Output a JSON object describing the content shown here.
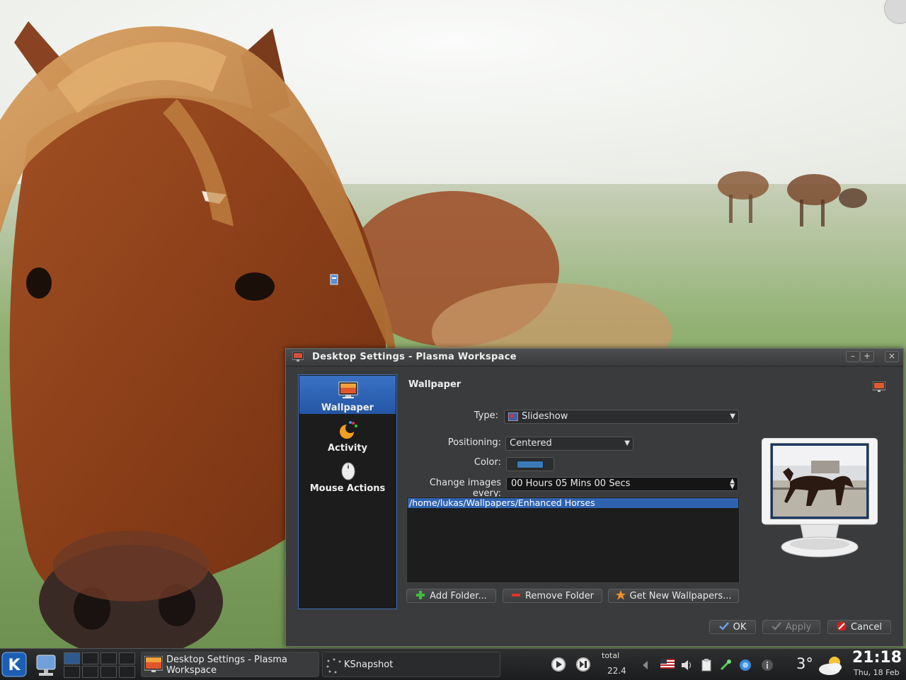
{
  "dialog": {
    "title": "Desktop Settings - Plasma Workspace",
    "window_buttons": {
      "minimize": "–",
      "maximize": "+",
      "close": "×"
    },
    "sidebar": {
      "items": [
        {
          "label": "Wallpaper",
          "icon": "wallpaper-icon",
          "selected": true
        },
        {
          "label": "Activity",
          "icon": "activity-icon",
          "selected": false
        },
        {
          "label": "Mouse Actions",
          "icon": "mouse-icon",
          "selected": false
        }
      ]
    },
    "section_title": "Wallpaper",
    "form": {
      "type_label": "Type:",
      "type_value": "Slideshow",
      "positioning_label": "Positioning:",
      "positioning_value": "Centered",
      "color_label": "Color:",
      "color_value": "#3a7ab8",
      "change_label": "Change images every:",
      "change_value": "00 Hours 05 Mins 00 Secs"
    },
    "folders": [
      "/home/lukas/Wallpapers/Enhanced Horses"
    ],
    "folder_buttons": {
      "add": "Add Folder...",
      "remove": "Remove Folder",
      "get_new": "Get New Wallpapers..."
    },
    "footer": {
      "ok": "OK",
      "apply": "Apply",
      "cancel": "Cancel"
    }
  },
  "taskbar": {
    "tasks": [
      {
        "label": "Desktop Settings - Plasma Workspace",
        "icon": "wallpaper-icon"
      },
      {
        "label": "KSnapshot",
        "icon": "loading-icon"
      }
    ],
    "net_widget": {
      "label": "total",
      "value": "22.4"
    },
    "weather": {
      "temp": "3°",
      "icon": "partly-cloudy-icon"
    },
    "clock": {
      "time": "21:18",
      "date": "Thu, 18 Feb"
    }
  },
  "colors": {
    "selection": "#2f63b0",
    "dialog_bg": "#3a3b3c",
    "taskbar_bg": "#1c1d1e"
  }
}
